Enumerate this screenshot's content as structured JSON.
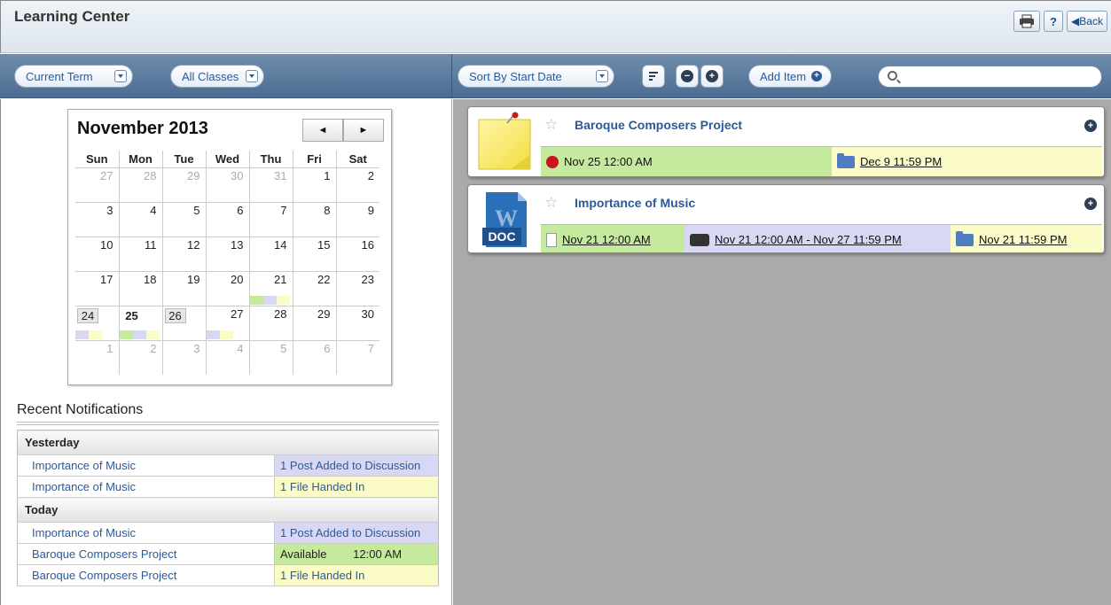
{
  "header": {
    "title": "Learning Center",
    "print_icon": "print-icon",
    "help_label": "?",
    "back_label": "◀Back"
  },
  "left_toolbar": {
    "term_select": "Current Term",
    "classes_select": "All Classes"
  },
  "right_toolbar": {
    "sort_select": "Sort By Start Date",
    "add_item_label": "Add Item",
    "search_placeholder": ""
  },
  "calendar": {
    "title": "November 2013",
    "prev_label": "◄",
    "next_label": "►",
    "weekdays": [
      "Sun",
      "Mon",
      "Tue",
      "Wed",
      "Thu",
      "Fri",
      "Sat"
    ],
    "weeks": [
      [
        "27",
        "28",
        "29",
        "30",
        "31",
        "1",
        "2"
      ],
      [
        "3",
        "4",
        "5",
        "6",
        "7",
        "8",
        "9"
      ],
      [
        "10",
        "11",
        "12",
        "13",
        "14",
        "15",
        "16"
      ],
      [
        "17",
        "18",
        "19",
        "20",
        "21",
        "22",
        "23"
      ],
      [
        "24",
        "25",
        "26",
        "27",
        "28",
        "29",
        "30"
      ],
      [
        "1",
        "2",
        "3",
        "4",
        "5",
        "6",
        "7"
      ]
    ]
  },
  "notifications": {
    "title": "Recent Notifications",
    "groups": [
      {
        "label": "Yesterday",
        "items": [
          {
            "item": "Importance of Music",
            "status": "1 Post Added to Discussion"
          },
          {
            "item": "Importance of Music",
            "status": "1 File Handed In"
          }
        ]
      },
      {
        "label": "Today",
        "items": [
          {
            "item": "Importance of Music",
            "status": "1 Post Added to Discussion"
          },
          {
            "item": "Baroque Composers Project",
            "status": "Available",
            "time": "12:00 AM"
          },
          {
            "item": "Baroque Composers Project",
            "status": "1 File Handed In"
          }
        ]
      }
    ]
  },
  "items": [
    {
      "title": "Baroque Composers Project",
      "thumb_icon": "sticky-note-icon",
      "start": "Nov 25 12:00 AM",
      "due": "Dec 9 11:59 PM"
    },
    {
      "title": "Importance of Music",
      "thumb_icon": "word-doc-icon",
      "thumb_label": "DOC",
      "start": "Nov 21 12:00 AM",
      "discussion": "Nov 21 12:00 AM - Nov 27 11:59 PM",
      "due": "Nov 21 11:59 PM"
    }
  ],
  "colors": {
    "purple": "#d8d8f4",
    "yellow": "#fbfbc8",
    "green": "#c5ea9e",
    "link_blue": "#2a5a9a"
  }
}
